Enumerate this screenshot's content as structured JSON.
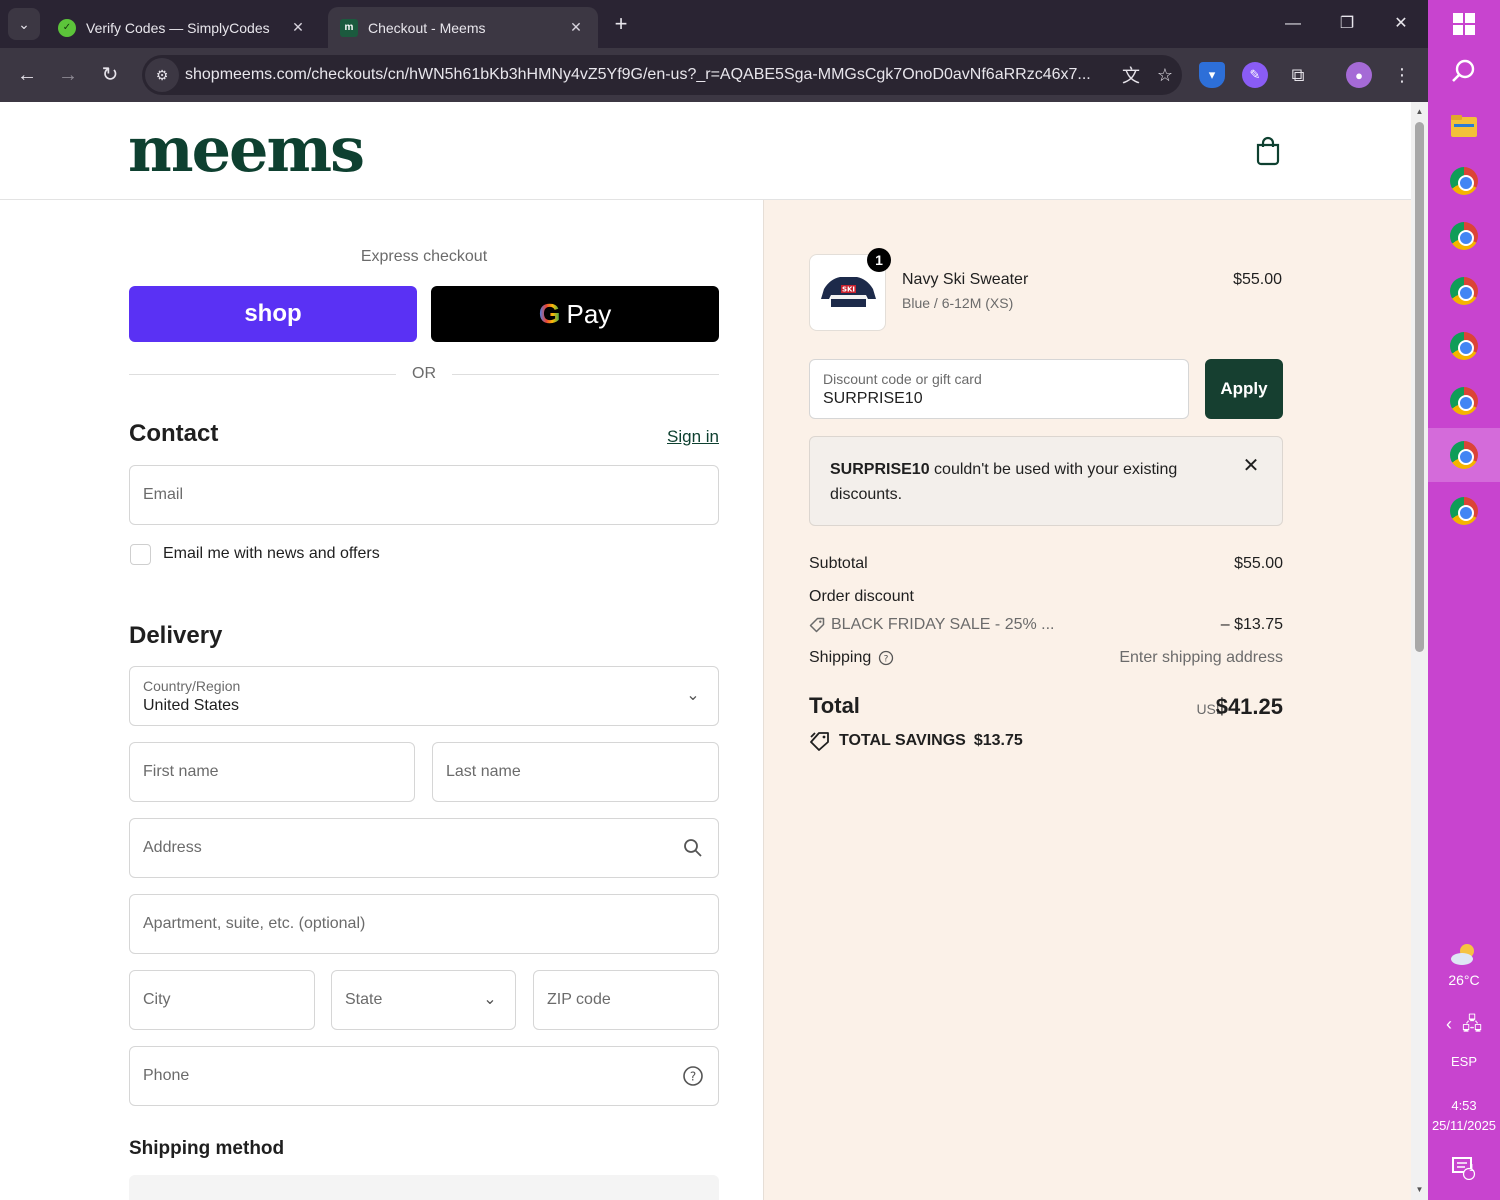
{
  "browser": {
    "tabs": [
      {
        "title": "Verify Codes — SimplyCodes",
        "active": false
      },
      {
        "title": "Checkout - Meems",
        "active": true
      }
    ],
    "url": "shopmeems.com/checkouts/cn/hWN5h61bKb3hHMNy4vZ5Yf9G/en-us?_r=AQABE5Sga-MMGsCgk7OnoD0avNf6aRRzc46x7..."
  },
  "header": {
    "logo_text": "meems"
  },
  "express": {
    "title": "Express checkout",
    "shop_label": "shop",
    "gpay_g": "G",
    "gpay_label": "Pay",
    "or_label": "OR"
  },
  "contact": {
    "title": "Contact",
    "sign_in": "Sign in",
    "email_placeholder": "Email",
    "newsletter_label": "Email me with news and offers"
  },
  "delivery": {
    "title": "Delivery",
    "country_label": "Country/Region",
    "country_value": "United States",
    "first_name_placeholder": "First name",
    "last_name_placeholder": "Last name",
    "address_placeholder": "Address",
    "apartment_placeholder": "Apartment, suite, etc. (optional)",
    "city_placeholder": "City",
    "state_placeholder": "State",
    "zip_placeholder": "ZIP code",
    "phone_placeholder": "Phone"
  },
  "shipping_method": {
    "title": "Shipping method"
  },
  "order": {
    "item": {
      "name": "Navy Ski Sweater",
      "variant": "Blue / 6-12M (XS)",
      "price": "$55.00",
      "quantity": "1",
      "image_text": "SKI"
    },
    "discount": {
      "label": "Discount code or gift card",
      "value": "SURPRISE10",
      "apply_label": "Apply",
      "error_code": "SURPRISE10",
      "error_text": " couldn't be used with your existing discounts."
    },
    "summary": {
      "subtotal_label": "Subtotal",
      "subtotal_value": "$55.00",
      "order_discount_label": "Order discount",
      "discount_name": "BLACK FRIDAY SALE - 25% ...",
      "discount_value": "– $13.75",
      "shipping_label": "Shipping",
      "shipping_value": "Enter shipping address",
      "total_label": "Total",
      "currency": "USD",
      "total_value": "$41.25",
      "savings_label": "TOTAL SAVINGS",
      "savings_value": "$13.75"
    }
  },
  "taskbar": {
    "weather": "26°C",
    "language": "ESP",
    "time": "4:53",
    "date": "25/11/2025",
    "notifications": "1"
  },
  "colors": {
    "brand": "#0e4030",
    "shop_pay": "#5a31f4",
    "summary_bg": "#fbf1e8",
    "taskbar": "#c844cf"
  }
}
